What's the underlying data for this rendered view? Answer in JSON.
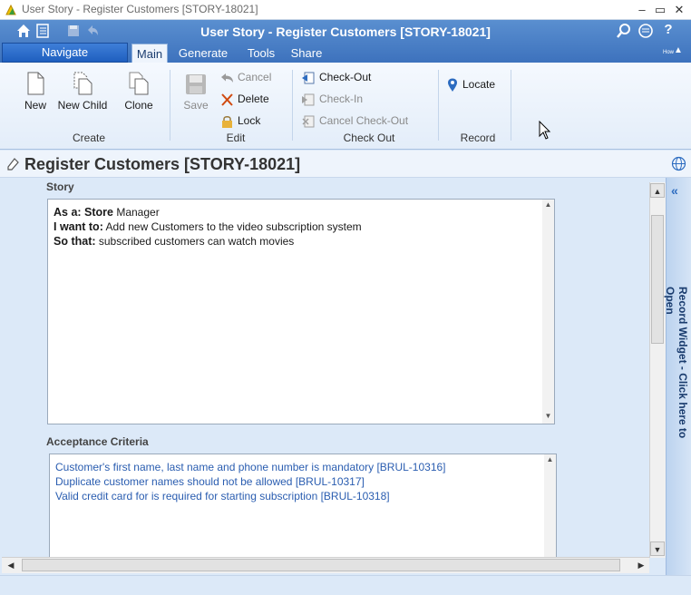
{
  "window": {
    "title": "User Story - Register Customers [STORY-18021]"
  },
  "header": {
    "title": "User Story - Register Customers [STORY-18021]"
  },
  "nav": {
    "navigate_label": "Navigate",
    "tabs": [
      {
        "label": "Main",
        "active": true
      },
      {
        "label": "Generate"
      },
      {
        "label": "Tools"
      },
      {
        "label": "Share"
      }
    ]
  },
  "ribbon": {
    "create": {
      "group_label": "Create",
      "new_label": "New",
      "new_child_label": "New Child",
      "clone_label": "Clone"
    },
    "edit": {
      "group_label": "Edit",
      "save_label": "Save",
      "cancel_label": "Cancel",
      "delete_label": "Delete",
      "lock_label": "Lock"
    },
    "checkout": {
      "group_label": "Check Out",
      "checkout_label": "Check-Out",
      "checkin_label": "Check-In",
      "cancel_checkout_label": "Cancel Check-Out"
    },
    "record": {
      "group_label": "Record",
      "locate_label": "Locate"
    }
  },
  "page": {
    "title": "Register Customers [STORY-18021]"
  },
  "story": {
    "label": "Story",
    "as_a_key": "As a: Store",
    "as_a_value": " Manager",
    "i_want_key": "I want to:",
    "i_want_value": " Add new Customers to the video subscription system",
    "so_that_key": "So that:",
    "so_that_value": " subscribed customers can watch movies"
  },
  "acceptance": {
    "label": "Acceptance Criteria",
    "items": [
      "Customer's first name, last name and phone number is mandatory [BRUL-10316]",
      "Duplicate customer names should not be allowed [BRUL-10317]",
      "Valid credit card for is required for starting subscription [BRUL-10318]"
    ]
  },
  "widget": {
    "label": "Record Widget - Click here to Open"
  },
  "help": {
    "label": "How"
  },
  "colors": {
    "header_blue": "#3d72bd",
    "link_blue": "#2a5db0"
  }
}
